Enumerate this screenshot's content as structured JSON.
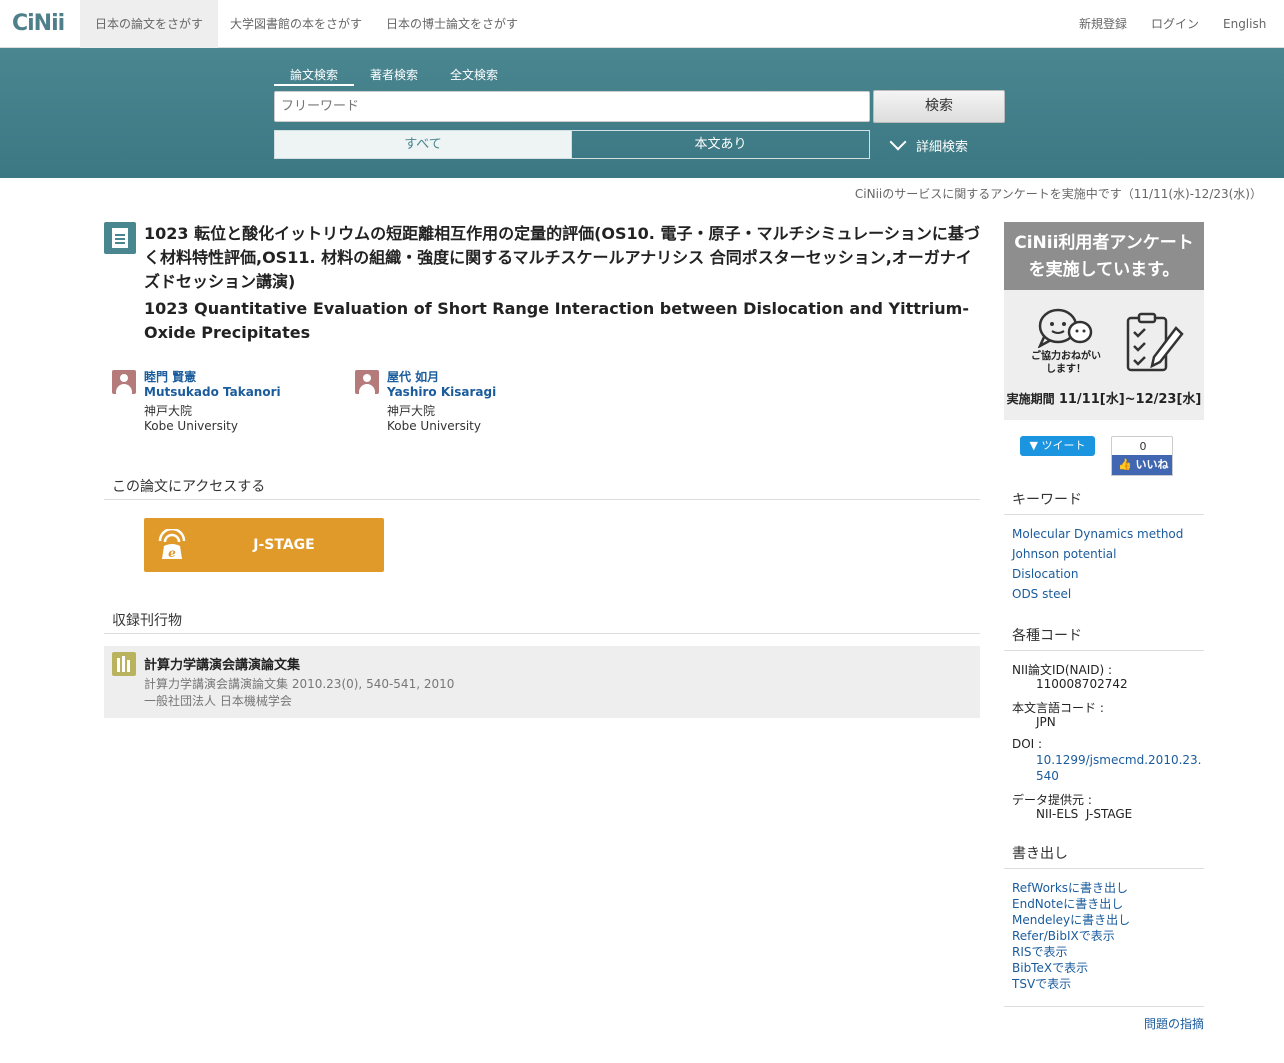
{
  "nav": {
    "logo": "CiNii",
    "tabs": [
      "日本の論文をさがす",
      "大学図書館の本をさがす",
      "日本の博士論文をさがす"
    ],
    "register": "新規登録",
    "login": "ログイン",
    "language": "English"
  },
  "search": {
    "tabs": [
      "論文検索",
      "著者検索",
      "全文検索"
    ],
    "placeholder": "フリーワード",
    "button": "検索",
    "filters": [
      "すべて",
      "本文あり"
    ],
    "advanced": "詳細検索"
  },
  "notice": "CiNiiのサービスに関するアンケートを実施中です（11/11(水)-12/23(水)）",
  "article": {
    "title_ja": "1023 転位と酸化イットリウムの短距離相互作用の定量的評価(OS10. 電子・原子・マルチシミュレーションに基づく材料特性評価,OS11. 材料の組織・強度に関するマルチスケールアナリシス 合同ポスターセッション,オーガナイズドセッション講演)",
    "title_en": "1023 Quantitative Evaluation of Short Range Interaction between Dislocation and Yittrium-Oxide Precipitates",
    "authors": [
      {
        "name_ja": "睦門 賢憲",
        "name_en": "Mutsukado Takanori",
        "aff_ja": "神戸大院",
        "aff_en": "Kobe University"
      },
      {
        "name_ja": "屋代 如月",
        "name_en": "Yashiro Kisaragi",
        "aff_ja": "神戸大院",
        "aff_en": "Kobe University"
      }
    ],
    "access_heading": "この論文にアクセスする",
    "jstage_label": "J-STAGE",
    "journal_heading": "収録刊行物",
    "journal": {
      "title": "計算力学講演会講演論文集",
      "detail": "計算力学講演会講演論文集 2010.23(0), 540-541, 2010",
      "publisher": "一般社団法人 日本機械学会"
    }
  },
  "sidebar": {
    "banner": {
      "line1": "CiNii利用者アンケート",
      "line2": "を実施しています。",
      "caption1": "ご協力おねがい",
      "caption2": "します！",
      "period_label": "実施期間",
      "period_value": "11/11[水]~12/23[水]"
    },
    "tweet": "ツイート",
    "like_count": "0",
    "like_label": "いいね",
    "keywords_heading": "キーワード",
    "keywords": [
      "Molecular Dynamics method",
      "Johnson potential",
      "Dislocation",
      "ODS steel"
    ],
    "codes_heading": "各種コード",
    "codes": [
      {
        "label": "NII論文ID(NAID) :",
        "value": "110008702742"
      },
      {
        "label": "本文言語コード :",
        "value": "JPN"
      },
      {
        "label": "DOI :",
        "value_line1": "10.1299/jsmecmd.2010.23.",
        "value_line2": "540"
      },
      {
        "label": "データ提供元 :",
        "value": "NII-ELS  J-STAGE"
      }
    ],
    "export_heading": "書き出し",
    "exports": [
      "RefWorksに書き出し",
      "EndNoteに書き出し",
      "Mendeleyに書き出し",
      "Refer/BibIXで表示",
      "RISで表示",
      "BibTeXで表示",
      "TSVで表示"
    ],
    "report": "問題の指摘"
  }
}
